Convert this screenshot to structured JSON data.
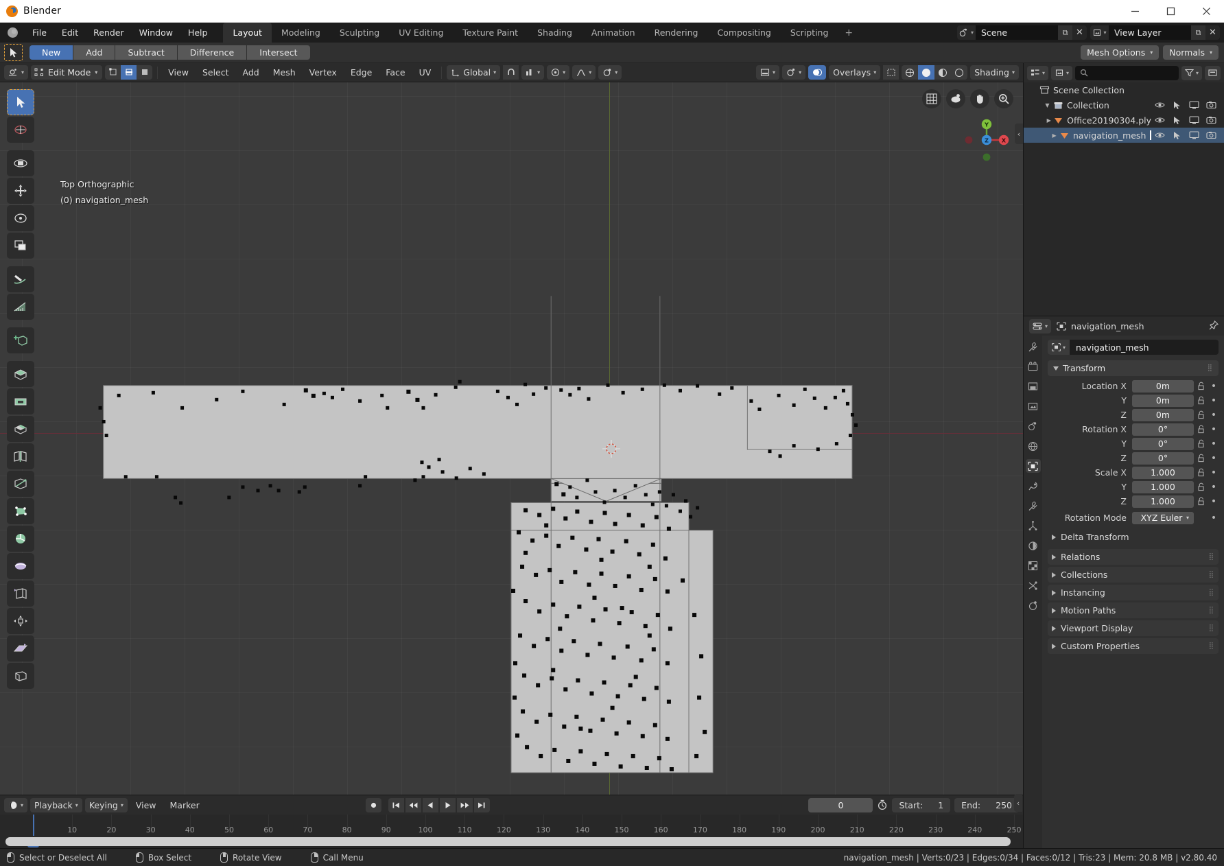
{
  "window": {
    "title": "Blender",
    "controls": {
      "minimize": "—",
      "maximize": "☐",
      "close": "✕"
    }
  },
  "topbar": {
    "menus": [
      "File",
      "Edit",
      "Render",
      "Window",
      "Help"
    ],
    "workspace_tabs": [
      {
        "label": "Layout",
        "active": true
      },
      {
        "label": "Modeling",
        "active": false
      },
      {
        "label": "Sculpting",
        "active": false
      },
      {
        "label": "UV Editing",
        "active": false
      },
      {
        "label": "Texture Paint",
        "active": false
      },
      {
        "label": "Shading",
        "active": false
      },
      {
        "label": "Animation",
        "active": false
      },
      {
        "label": "Rendering",
        "active": false
      },
      {
        "label": "Compositing",
        "active": false
      },
      {
        "label": "Scripting",
        "active": false
      }
    ],
    "add_tab": "+",
    "scene": {
      "name": "Scene",
      "copy": "⧉",
      "close": "✕"
    },
    "view_layer": {
      "name": "View Layer",
      "copy": "⧉",
      "close": "✕"
    }
  },
  "tool_settings": {
    "boolean_modes": [
      {
        "label": "New",
        "active": true
      },
      {
        "label": "Add",
        "active": false
      },
      {
        "label": "Subtract",
        "active": false
      },
      {
        "label": "Difference",
        "active": false
      },
      {
        "label": "Intersect",
        "active": false
      }
    ],
    "right": [
      {
        "label": "Mesh Options"
      },
      {
        "label": "Normals"
      }
    ]
  },
  "viewport_header": {
    "mode": "Edit Mode",
    "menus": [
      "View",
      "Select",
      "Add",
      "Mesh",
      "Vertex",
      "Edge",
      "Face",
      "UV"
    ],
    "transform_orientation": "Global",
    "overlays_label": "Shading",
    "overlays_button": "Overlays",
    "select_modes": [
      "vertex-select",
      "edge-select",
      "face-select"
    ],
    "active_select_mode": 1
  },
  "viewport": {
    "view_name": "Top Orthographic",
    "object_info": "(0) navigation_mesh",
    "gizmo_axes": {
      "x": "X",
      "y": "Y",
      "z": "Z"
    },
    "gizmo_buttons": [
      "camera-perspective-icon",
      "hand-pan-icon",
      "zoom-icon"
    ],
    "colors": {
      "background": "#3b3b3b",
      "mesh_fill": "#c4c4c4",
      "vertex": "#000000",
      "axis_x": "#6a2d38",
      "axis_y": "#5b6a33",
      "accent": "#4772b3",
      "tool_highlight": "#e5a33b"
    }
  },
  "toolbar": {
    "tools": [
      {
        "name": "tweak-select-box",
        "active": true
      },
      {
        "name": "cursor"
      },
      {
        "name": "move-alt"
      },
      {
        "name": "move"
      },
      {
        "name": "rotate"
      },
      {
        "name": "scale"
      },
      {
        "name": "annotate"
      },
      {
        "name": "measure"
      },
      {
        "name": "add-cube"
      },
      {
        "name": "extrude-region"
      },
      {
        "name": "inset-faces"
      },
      {
        "name": "bevel"
      },
      {
        "name": "loop-cut"
      },
      {
        "name": "knife"
      },
      {
        "name": "poly-build"
      },
      {
        "name": "spin"
      },
      {
        "name": "smooth"
      },
      {
        "name": "edge-slide"
      },
      {
        "name": "shrink-fatten"
      },
      {
        "name": "shear"
      },
      {
        "name": "rip-region"
      }
    ]
  },
  "outliner": {
    "search_placeholder": "",
    "rows": [
      {
        "label": "Scene Collection",
        "depth": 0,
        "icon": "scene-collection-icon",
        "expander": "",
        "selected": false,
        "show_icons": false
      },
      {
        "label": "Collection",
        "depth": 1,
        "icon": "collection-icon",
        "expander": "down",
        "selected": false,
        "show_icons": true
      },
      {
        "label": "Office20190304.ply",
        "depth": 2,
        "icon": "mesh-object-icon",
        "expander": "right",
        "selected": false,
        "show_icons": true
      },
      {
        "label": "navigation_mesh",
        "depth": 2,
        "icon": "mesh-object-icon",
        "expander": "right",
        "selected": true,
        "show_icons": true
      }
    ],
    "row_icons": [
      "eye-icon",
      "cursor-arrow-icon",
      "monitor-icon",
      "camera-icon"
    ]
  },
  "properties": {
    "breadcrumb_object": "navigation_mesh",
    "name_field": "navigation_mesh",
    "pin_icon": "pin-icon",
    "panels": {
      "transform": {
        "title": "Transform",
        "rows": [
          {
            "label": "Location X",
            "value": "0m"
          },
          {
            "label": "Y",
            "value": "0m"
          },
          {
            "label": "Z",
            "value": "0m"
          },
          {
            "label": "Rotation X",
            "value": "0°"
          },
          {
            "label": "Y",
            "value": "0°"
          },
          {
            "label": "Z",
            "value": "0°"
          },
          {
            "label": "Scale X",
            "value": "1.000"
          },
          {
            "label": "Y",
            "value": "1.000"
          },
          {
            "label": "Z",
            "value": "1.000"
          }
        ],
        "rotation_mode_label": "Rotation Mode",
        "rotation_mode_value": "XYZ Euler",
        "delta_transform": "Delta Transform"
      },
      "collapsed": [
        "Relations",
        "Collections",
        "Instancing",
        "Motion Paths",
        "Viewport Display",
        "Custom Properties"
      ]
    },
    "tabs": [
      "tool-tab",
      "render-tab",
      "output-tab",
      "view-layer-tab",
      "scene-tab",
      "world-tab",
      "object-tab",
      "modifiers-tab",
      "particles-tab",
      "physics-tab",
      "constraints-tab",
      "data-tab",
      "material-tab",
      "texture-tab"
    ],
    "active_tab_index": 6
  },
  "timeline": {
    "editor_menus": [
      "Playback",
      "Keying",
      "View",
      "Marker"
    ],
    "transport": [
      "record",
      "jump-to-start",
      "prev-keyframe",
      "play-reverse",
      "play",
      "next-keyframe",
      "jump-to-end"
    ],
    "current_frame": "0",
    "start_label": "Start:",
    "start_value": "1",
    "end_label": "End:",
    "end_value": "250",
    "ruler_ticks": [
      0,
      10,
      20,
      30,
      40,
      50,
      60,
      70,
      80,
      90,
      100,
      110,
      120,
      130,
      140,
      150,
      160,
      170,
      180,
      190,
      200,
      210,
      220,
      230,
      240,
      250
    ],
    "playhead_label": "0"
  },
  "statusbar": {
    "hints": [
      {
        "mouse": "left",
        "label": "Select or Deselect All"
      },
      {
        "mouse": "left-drag",
        "label": "Box Select"
      },
      {
        "mouse": "middle",
        "label": "Rotate View"
      },
      {
        "mouse": "right",
        "label": "Call Menu"
      }
    ],
    "stats": "navigation_mesh | Verts:0/23 | Edges:0/34 | Faces:0/12 | Tris:23 | Mem: 20.8 MB | v2.80.40"
  }
}
